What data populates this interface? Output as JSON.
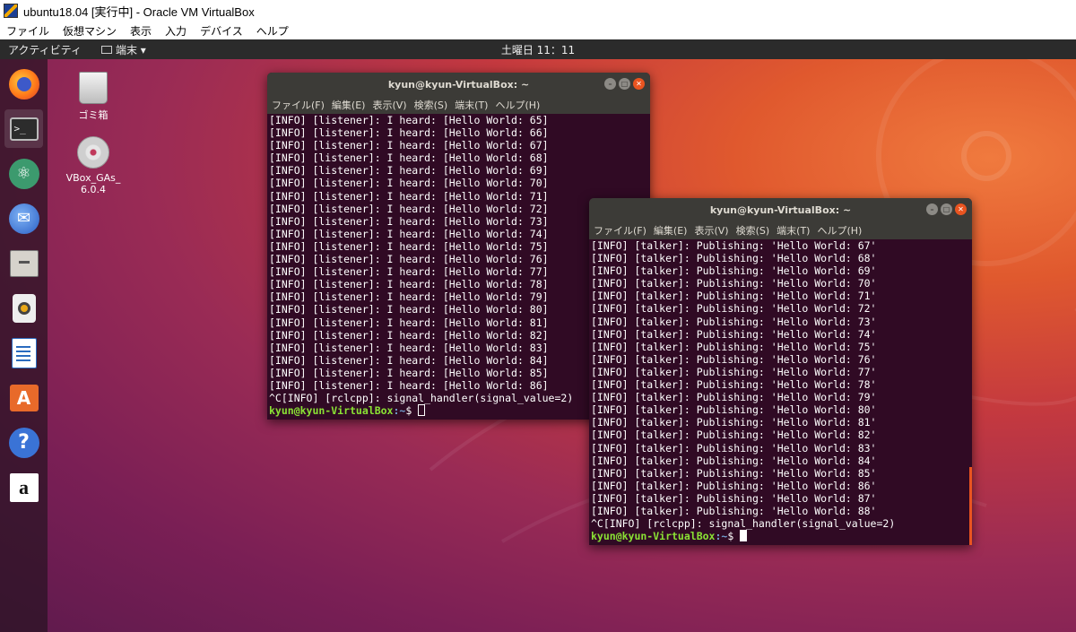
{
  "host": {
    "title": "ubuntu18.04 [実行中] - Oracle VM VirtualBox",
    "menu": [
      "ファイル",
      "仮想マシン",
      "表示",
      "入力",
      "デバイス",
      "ヘルプ"
    ]
  },
  "topbar": {
    "activities": "アクティビティ",
    "app_menu": "端末 ▾",
    "clock": "土曜日 11：11"
  },
  "dock": {
    "items": [
      "firefox-icon",
      "terminal-icon",
      "atom-icon",
      "thunderbird-icon",
      "files-icon",
      "rhythmbox-icon",
      "writer-icon",
      "software-icon",
      "help-icon",
      "amazon-icon"
    ]
  },
  "desktop": {
    "trash_label": "ゴミ箱",
    "disc_label_line1": "VBox_GAs_",
    "disc_label_line2": "6.0.4"
  },
  "term1": {
    "title": "kyun@kyun-VirtualBox: ~",
    "menu": [
      "ファイル(F)",
      "編集(E)",
      "表示(V)",
      "検索(S)",
      "端末(T)",
      "ヘルプ(H)"
    ],
    "lines": [
      "[INFO] [listener]: I heard: [Hello World: 65]",
      "[INFO] [listener]: I heard: [Hello World: 66]",
      "[INFO] [listener]: I heard: [Hello World: 67]",
      "[INFO] [listener]: I heard: [Hello World: 68]",
      "[INFO] [listener]: I heard: [Hello World: 69]",
      "[INFO] [listener]: I heard: [Hello World: 70]",
      "[INFO] [listener]: I heard: [Hello World: 71]",
      "[INFO] [listener]: I heard: [Hello World: 72]",
      "[INFO] [listener]: I heard: [Hello World: 73]",
      "[INFO] [listener]: I heard: [Hello World: 74]",
      "[INFO] [listener]: I heard: [Hello World: 75]",
      "[INFO] [listener]: I heard: [Hello World: 76]",
      "[INFO] [listener]: I heard: [Hello World: 77]",
      "[INFO] [listener]: I heard: [Hello World: 78]",
      "[INFO] [listener]: I heard: [Hello World: 79]",
      "[INFO] [listener]: I heard: [Hello World: 80]",
      "[INFO] [listener]: I heard: [Hello World: 81]",
      "[INFO] [listener]: I heard: [Hello World: 82]",
      "[INFO] [listener]: I heard: [Hello World: 83]",
      "[INFO] [listener]: I heard: [Hello World: 84]",
      "[INFO] [listener]: I heard: [Hello World: 85]",
      "[INFO] [listener]: I heard: [Hello World: 86]",
      "^C[INFO] [rclcpp]: signal_handler(signal_value=2)"
    ],
    "prompt_user": "kyun@kyun-VirtualBox",
    "prompt_path": ":~",
    "prompt_symbol": "$ "
  },
  "term2": {
    "title": "kyun@kyun-VirtualBox: ~",
    "menu": [
      "ファイル(F)",
      "編集(E)",
      "表示(V)",
      "検索(S)",
      "端末(T)",
      "ヘルプ(H)"
    ],
    "lines": [
      "[INFO] [talker]: Publishing: 'Hello World: 67'",
      "[INFO] [talker]: Publishing: 'Hello World: 68'",
      "[INFO] [talker]: Publishing: 'Hello World: 69'",
      "[INFO] [talker]: Publishing: 'Hello World: 70'",
      "[INFO] [talker]: Publishing: 'Hello World: 71'",
      "[INFO] [talker]: Publishing: 'Hello World: 72'",
      "[INFO] [talker]: Publishing: 'Hello World: 73'",
      "[INFO] [talker]: Publishing: 'Hello World: 74'",
      "[INFO] [talker]: Publishing: 'Hello World: 75'",
      "[INFO] [talker]: Publishing: 'Hello World: 76'",
      "[INFO] [talker]: Publishing: 'Hello World: 77'",
      "[INFO] [talker]: Publishing: 'Hello World: 78'",
      "[INFO] [talker]: Publishing: 'Hello World: 79'",
      "[INFO] [talker]: Publishing: 'Hello World: 80'",
      "[INFO] [talker]: Publishing: 'Hello World: 81'",
      "[INFO] [talker]: Publishing: 'Hello World: 82'",
      "[INFO] [talker]: Publishing: 'Hello World: 83'",
      "[INFO] [talker]: Publishing: 'Hello World: 84'",
      "[INFO] [talker]: Publishing: 'Hello World: 85'",
      "[INFO] [talker]: Publishing: 'Hello World: 86'",
      "[INFO] [talker]: Publishing: 'Hello World: 87'",
      "[INFO] [talker]: Publishing: 'Hello World: 88'",
      "^C[INFO] [rclcpp]: signal_handler(signal_value=2)"
    ],
    "prompt_user": "kyun@kyun-VirtualBox",
    "prompt_path": ":~",
    "prompt_symbol": "$ "
  },
  "colors": {
    "terminal_bg": "#300a24",
    "prompt_user": "#8ae234",
    "prompt_path": "#729fcf",
    "accent": "#e95420"
  }
}
